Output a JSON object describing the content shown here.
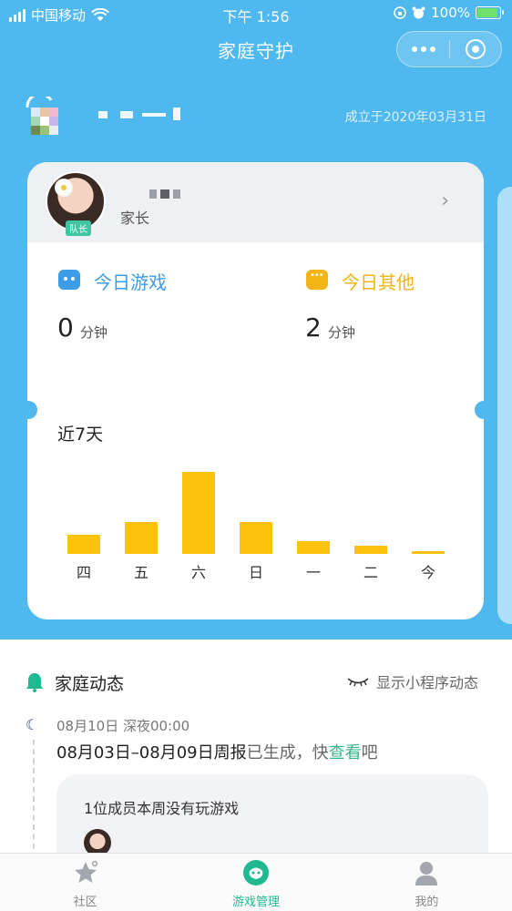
{
  "status_bar": {
    "carrier": "中国移动",
    "time": "下午 1:56",
    "battery": "100%",
    "icons": [
      "signal-icon",
      "wifi-icon",
      "orientation-lock-icon",
      "alarm-icon",
      "battery-icon"
    ]
  },
  "nav": {
    "title": "家庭守护",
    "icons": [
      "more-icon",
      "close-miniprogram-icon"
    ]
  },
  "family": {
    "founded": "成立于2020年03月31日"
  },
  "member": {
    "role": "家长",
    "badge": "队长"
  },
  "today": {
    "game_label": "今日游戏",
    "game_value": "0",
    "game_unit": "分钟",
    "other_label": "今日其他",
    "other_value": "2",
    "other_unit": "分钟"
  },
  "chart_data": {
    "type": "bar",
    "title": "近7天",
    "categories": [
      "四",
      "五",
      "六",
      "日",
      "一",
      "二",
      "今"
    ],
    "values": [
      21,
      35,
      90,
      35,
      14,
      9,
      3
    ],
    "ylim": [
      0,
      100
    ],
    "color": "#fdc20b",
    "grid": false
  },
  "feed": {
    "title": "家庭动态",
    "toggle": "显示小程序动态",
    "time": "08月10日 深夜00:00",
    "report_main": "08月03日–08月09日周报",
    "report_mid": "已生成，快",
    "report_link": "查看",
    "report_end": "吧",
    "card_message": "1位成员本周没有玩游戏"
  },
  "tabbar": [
    {
      "label": "社区",
      "icon": "community-icon"
    },
    {
      "label": "游戏管理",
      "icon": "game-management-icon"
    },
    {
      "label": "我的",
      "icon": "profile-icon"
    }
  ],
  "colors": {
    "header_bg": "#4fb9ef",
    "game_blue": "#3d9ce8",
    "other_yellow": "#f2b515",
    "bar_yellow": "#fdc20b",
    "active_green": "#1fb891"
  }
}
